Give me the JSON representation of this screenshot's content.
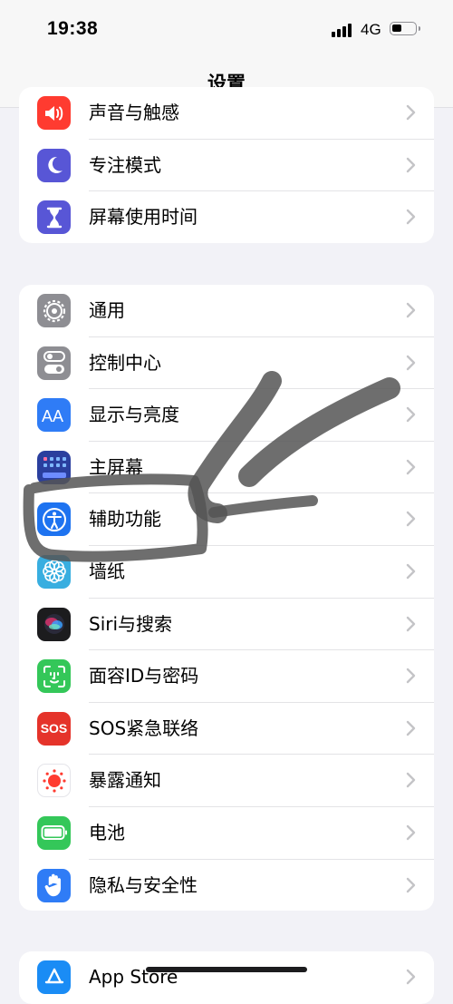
{
  "status": {
    "time": "19:38",
    "network": "4G"
  },
  "nav": {
    "title": "设置"
  },
  "group1": [
    {
      "label": "声音与触感",
      "icon": "speaker-icon",
      "color": "#ff3b30"
    },
    {
      "label": "专注模式",
      "icon": "moon-icon",
      "color": "#5856d6"
    },
    {
      "label": "屏幕使用时间",
      "icon": "hourglass-icon",
      "color": "#5856d6"
    }
  ],
  "group2": [
    {
      "label": "通用",
      "icon": "gear-icon",
      "color": "#8e8e93"
    },
    {
      "label": "控制中心",
      "icon": "toggles-icon",
      "color": "#8e8e93"
    },
    {
      "label": "显示与亮度",
      "icon": "aa-icon",
      "color": "#2f7cf6"
    },
    {
      "label": "主屏幕",
      "icon": "home-grid-icon",
      "color": "#2a3f9e"
    },
    {
      "label": "辅助功能",
      "icon": "accessibility-icon",
      "color": "#1e73f0"
    },
    {
      "label": "墙纸",
      "icon": "flower-icon",
      "color": "#38aee0"
    },
    {
      "label": "Siri与搜索",
      "icon": "siri-icon",
      "color": "#1c1c1e"
    },
    {
      "label": "面容ID与密码",
      "icon": "faceid-icon",
      "color": "#34c759"
    },
    {
      "label": "SOS紧急联络",
      "icon": "sos-icon",
      "color": "#e5332a",
      "icon_text": "SOS"
    },
    {
      "label": "暴露通知",
      "icon": "exposure-icon",
      "color": "#ffffff"
    },
    {
      "label": "电池",
      "icon": "battery-icon",
      "color": "#34c759"
    },
    {
      "label": "隐私与安全性",
      "icon": "hand-icon",
      "color": "#2f7cf6"
    }
  ],
  "group3": [
    {
      "label": "App Store",
      "icon": "appstore-icon",
      "color": "#1a8cf5"
    }
  ]
}
